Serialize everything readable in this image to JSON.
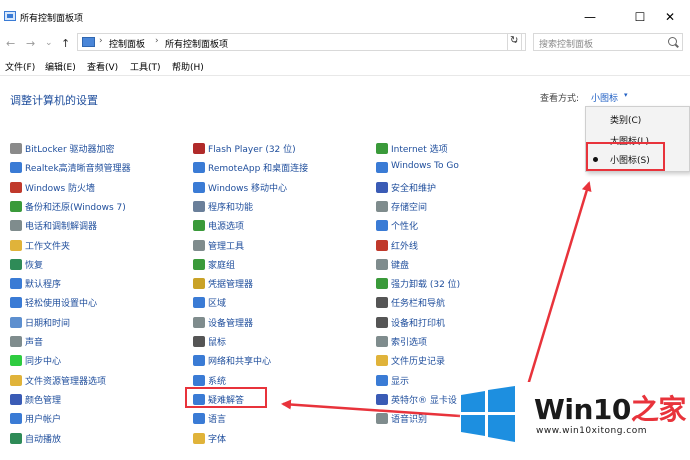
{
  "window": {
    "title": "所有控制面板项",
    "minimize": "—",
    "maximize": "☐",
    "close": "✕"
  },
  "address_bar": {
    "back": "←",
    "forward": "→",
    "dropdown": "⌄",
    "up": "↑",
    "crumb_sep": "›",
    "crumbs": [
      "控制面板",
      "所有控制面板项"
    ],
    "refresh": "↻",
    "search_placeholder": "搜索控制面板"
  },
  "menu": [
    "文件(F)",
    "编辑(E)",
    "查看(V)",
    "工具(T)",
    "帮助(H)"
  ],
  "header": {
    "title": "调整计算机的设置",
    "view_by_label": "查看方式:",
    "view_by_value": "小图标",
    "caret": "▾"
  },
  "view_menu": {
    "options": [
      "类别(C)",
      "大图标(L)",
      "小图标(S)"
    ],
    "selected": "小图标(S)"
  },
  "columns": [
    [
      {
        "label": "BitLocker 驱动器加密",
        "icon": "bitlocker-icon",
        "color": "#8a8a8a"
      },
      {
        "label": "Realtek高清晰音频管理器",
        "icon": "audio-manager-icon",
        "color": "#3a7bd5"
      },
      {
        "label": "Windows 防火墙",
        "icon": "firewall-icon",
        "color": "#c0392b"
      },
      {
        "label": "备份和还原(Windows 7)",
        "icon": "backup-icon",
        "color": "#3a9a3a"
      },
      {
        "label": "电话和调制解调器",
        "icon": "phone-modem-icon",
        "color": "#7f8c8d"
      },
      {
        "label": "工作文件夹",
        "icon": "work-folders-icon",
        "color": "#e0b33a"
      },
      {
        "label": "恢复",
        "icon": "recovery-icon",
        "color": "#2e8b57"
      },
      {
        "label": "默认程序",
        "icon": "default-programs-icon",
        "color": "#3a7bd5"
      },
      {
        "label": "轻松使用设置中心",
        "icon": "ease-of-access-icon",
        "color": "#3a7bd5"
      },
      {
        "label": "日期和时间",
        "icon": "date-time-icon",
        "color": "#5d8fcf"
      },
      {
        "label": "声音",
        "icon": "sound-icon",
        "color": "#7f8c8d"
      },
      {
        "label": "同步中心",
        "icon": "sync-center-icon",
        "color": "#2ecc40"
      },
      {
        "label": "文件资源管理器选项",
        "icon": "explorer-options-icon",
        "color": "#e0b33a"
      },
      {
        "label": "颜色管理",
        "icon": "color-management-icon",
        "color": "#3a5bb5"
      },
      {
        "label": "用户帐户",
        "icon": "user-accounts-icon",
        "color": "#3a7bd5"
      },
      {
        "label": "自动播放",
        "icon": "autoplay-icon",
        "color": "#2e8b57"
      }
    ],
    [
      {
        "label": "Flash Player (32 位)",
        "icon": "flash-player-icon",
        "color": "#b02a2a"
      },
      {
        "label": "RemoteApp 和桌面连接",
        "icon": "remoteapp-icon",
        "color": "#3a7bd5"
      },
      {
        "label": "Windows 移动中心",
        "icon": "mobility-center-icon",
        "color": "#3a7bd5"
      },
      {
        "label": "程序和功能",
        "icon": "programs-features-icon",
        "color": "#6a7f9a"
      },
      {
        "label": "电源选项",
        "icon": "power-options-icon",
        "color": "#3a9a3a"
      },
      {
        "label": "管理工具",
        "icon": "admin-tools-icon",
        "color": "#7f8c8d"
      },
      {
        "label": "家庭组",
        "icon": "homegroup-icon",
        "color": "#3a9a3a"
      },
      {
        "label": "凭据管理器",
        "icon": "credential-manager-icon",
        "color": "#c9a227"
      },
      {
        "label": "区域",
        "icon": "region-icon",
        "color": "#3a7bd5"
      },
      {
        "label": "设备管理器",
        "icon": "device-manager-icon",
        "color": "#7f8c8d"
      },
      {
        "label": "鼠标",
        "icon": "mouse-icon",
        "color": "#555555"
      },
      {
        "label": "网络和共享中心",
        "icon": "network-center-icon",
        "color": "#3a7bd5"
      },
      {
        "label": "系统",
        "icon": "system-icon",
        "color": "#3a7bd5"
      },
      {
        "label": "疑难解答",
        "icon": "troubleshooting-icon",
        "color": "#3a7bd5"
      },
      {
        "label": "语言",
        "icon": "language-icon",
        "color": "#3a7bd5"
      },
      {
        "label": "字体",
        "icon": "fonts-icon",
        "color": "#e0b33a"
      }
    ],
    [
      {
        "label": "Internet 选项",
        "icon": "internet-options-icon",
        "color": "#3a9a3a"
      },
      {
        "label": "Windows To Go",
        "icon": "windows-to-go-icon",
        "color": "#3a7bd5"
      },
      {
        "label": "安全和维护",
        "icon": "security-maintenance-icon",
        "color": "#3a5bb5"
      },
      {
        "label": "存储空间",
        "icon": "storage-spaces-icon",
        "color": "#7f8c8d"
      },
      {
        "label": "个性化",
        "icon": "personalization-icon",
        "color": "#3a7bd5"
      },
      {
        "label": "红外线",
        "icon": "infrared-icon",
        "color": "#c0392b"
      },
      {
        "label": "键盘",
        "icon": "keyboard-icon",
        "color": "#7f8c8d"
      },
      {
        "label": "强力卸载 (32 位)",
        "icon": "uninstall-icon",
        "color": "#3a9a3a"
      },
      {
        "label": "任务栏和导航",
        "icon": "taskbar-icon",
        "color": "#555555"
      },
      {
        "label": "设备和打印机",
        "icon": "devices-printers-icon",
        "color": "#555555"
      },
      {
        "label": "索引选项",
        "icon": "indexing-icon",
        "color": "#7f8c8d"
      },
      {
        "label": "文件历史记录",
        "icon": "file-history-icon",
        "color": "#e0b33a"
      },
      {
        "label": "显示",
        "icon": "display-icon",
        "color": "#3a7bd5"
      },
      {
        "label": "英特尔® 显卡设",
        "icon": "intel-graphics-icon",
        "color": "#3a5bb5"
      },
      {
        "label": "语音识别",
        "icon": "speech-icon",
        "color": "#7f8c8d"
      }
    ]
  ],
  "watermark": {
    "brand": "Win10",
    "brand_cn": "之家",
    "url": "www.win10xitong.com"
  }
}
